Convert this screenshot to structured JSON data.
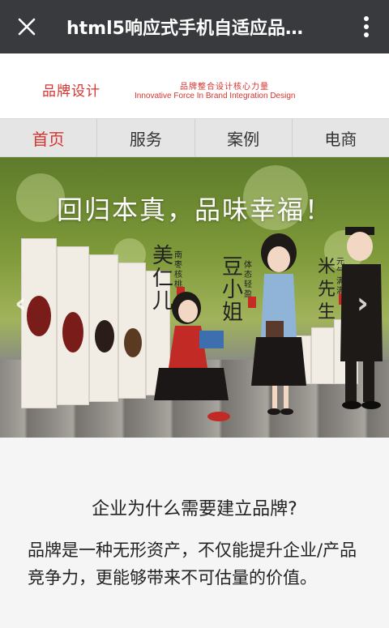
{
  "appbar": {
    "title": "html5响应式手机自适应品…",
    "close_icon": "close-icon",
    "more_icon": "more-vertical-icon"
  },
  "brand": {
    "logo_text": "品牌设计",
    "tagline_cn": "品牌整合设计核心力量",
    "tagline_en": "Innovative Force In Brand Integration Design",
    "color": "#d8322e"
  },
  "nav": {
    "tabs": [
      {
        "label": "首页",
        "active": true
      },
      {
        "label": "服务",
        "active": false
      },
      {
        "label": "案例",
        "active": false
      },
      {
        "label": "电商",
        "active": false
      }
    ]
  },
  "banner": {
    "headline": "回归本真，品味幸福！",
    "product_names": [
      "美仁儿",
      "豆小姐",
      "米先生"
    ],
    "product_notes": [
      "南枣核桃",
      "体态轻盈",
      "元气满满"
    ]
  },
  "content": {
    "question": "企业为什么需要建立品牌?",
    "answer": "品牌是一种无形资产，不仅能提升企业/产品竞争力，更能够带来不可估量的价值。"
  }
}
